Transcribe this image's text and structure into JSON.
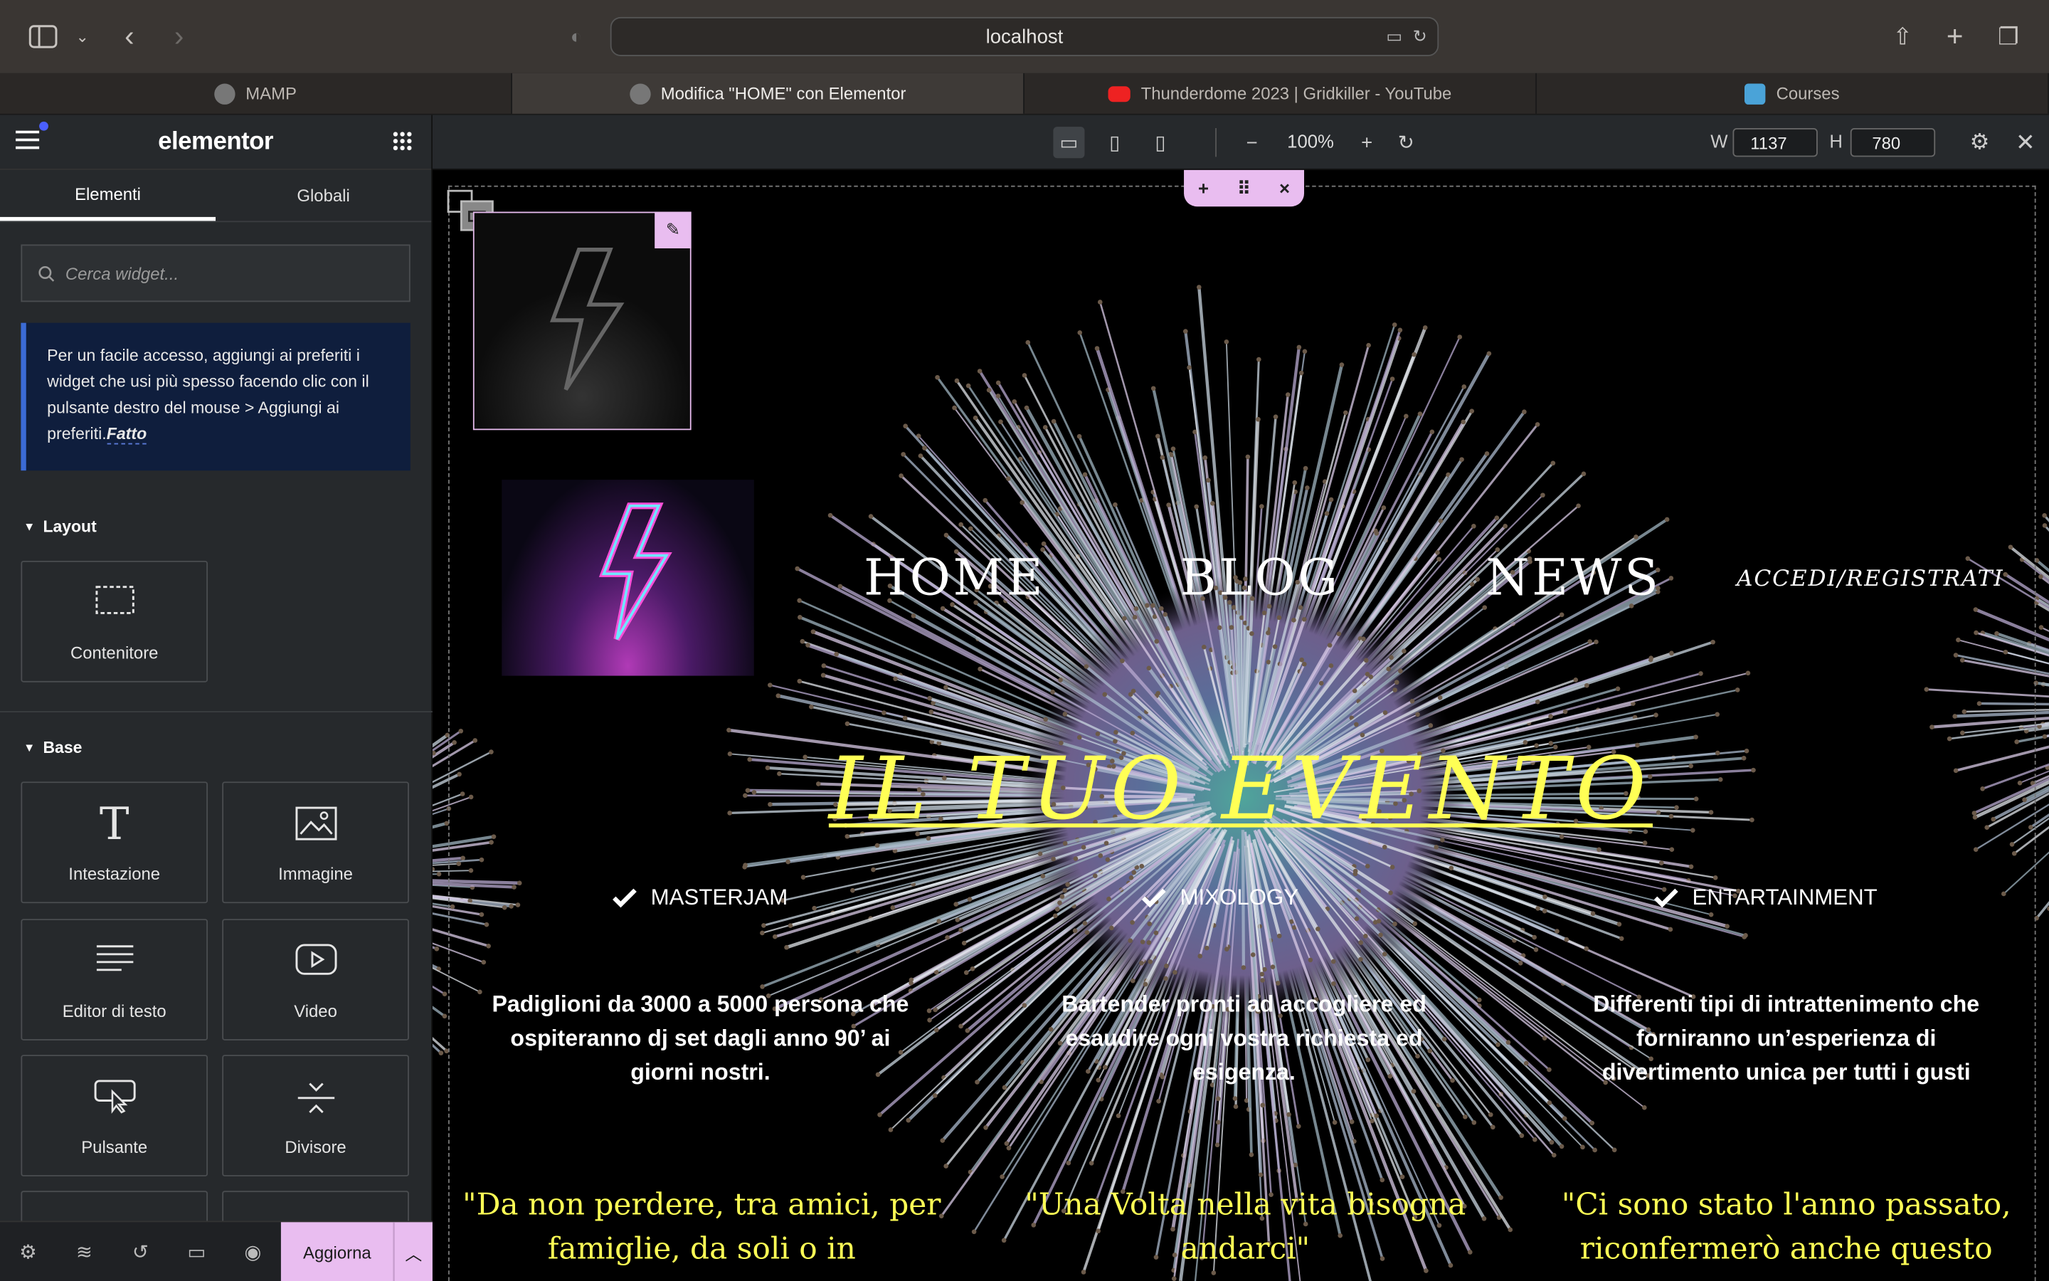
{
  "browser": {
    "url": "localhost",
    "tabs": [
      {
        "title": "MAMP",
        "active": false,
        "favicon": "mamp-icon"
      },
      {
        "title": "Modifica \"HOME\" con Elementor",
        "active": true,
        "favicon": "mamp-icon"
      },
      {
        "title": "Thunderdome 2023 | Gridkiller - YouTube",
        "active": false,
        "favicon": "youtube-icon"
      },
      {
        "title": "Courses",
        "active": false,
        "favicon": "courses-icon"
      }
    ]
  },
  "panel": {
    "logo": "elementor",
    "tabs": [
      "Elementi",
      "Globali"
    ],
    "search_placeholder": "Cerca widget...",
    "notice_text": "Per un facile accesso, aggiungi ai preferiti i widget che usi più spesso facendo clic con il pulsante destro del mouse > Aggiungi ai preferiti.",
    "notice_action": "Fatto",
    "sections": [
      {
        "title": "Layout",
        "widgets": [
          "Contenitore"
        ]
      },
      {
        "title": "Base",
        "widgets": [
          "Intestazione",
          "Immagine",
          "Editor di testo",
          "Video",
          "Pulsante",
          "Divisore"
        ]
      }
    ],
    "footer": {
      "update_label": "Aggiorna"
    }
  },
  "topbar": {
    "zoom": "100%",
    "width_label": "W",
    "width_value": "1137",
    "height_label": "H",
    "height_value": "780"
  },
  "page": {
    "nav": [
      "HOME",
      "BLOG",
      "NEWS",
      "ACCEDI/REGISTRATI"
    ],
    "hero_title": "IL TUO EVENTO",
    "features": [
      {
        "label": "MASTERJAM",
        "desc": "Padiglioni da 3000 a 5000 persona che ospiteranno dj set dagli anno 90’ ai giorni nostri.",
        "quote": "\"Da non perdere, tra amici, per famiglie, da soli o in compagnia\""
      },
      {
        "label": "MIXOLOGY",
        "desc": "Bartender pronti ad accogliere ed esaudire ogni vostra richiesta ed esigenza.",
        "quote": "\"Una Volta nella vita bisogna andarci\""
      },
      {
        "label": "ENTARTAINMENT",
        "desc": "Differenti tipi di intrattenimento che forniranno un’esperienza di divertimento unica per tutti i gusti",
        "quote": "\"Ci sono stato l'anno passato, riconfermerò anche questo anno,"
      }
    ]
  },
  "colors": {
    "accent_pink": "#e9bdf0",
    "hero_yellow": "#ffff55",
    "panel_bg": "#26292c",
    "notice_bg": "#0f1e3d"
  }
}
